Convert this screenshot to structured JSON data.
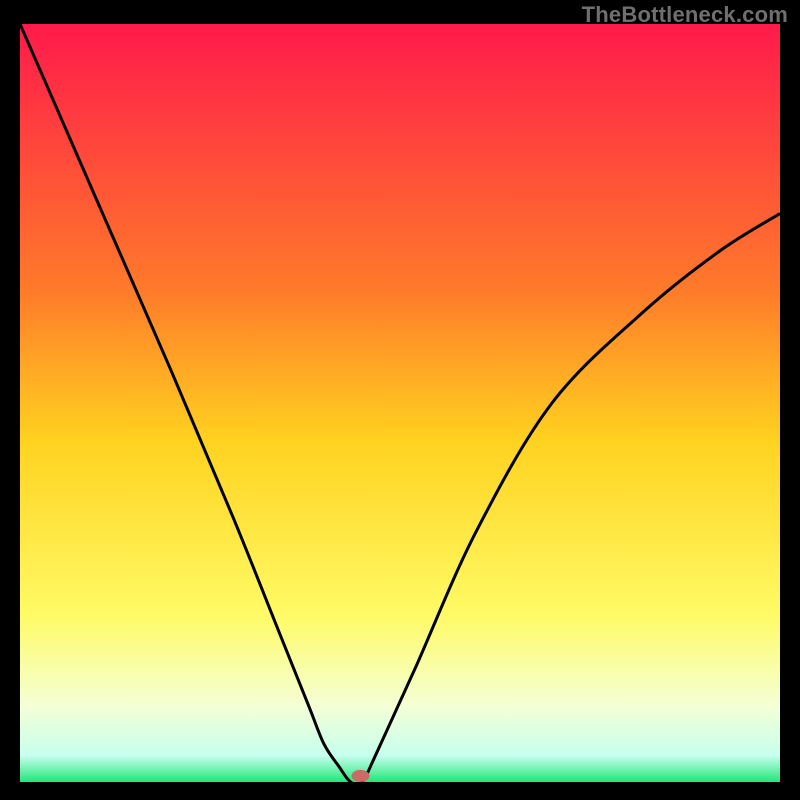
{
  "watermark": "TheBottleneck.com",
  "chart_data": {
    "type": "line",
    "title": "",
    "xlabel": "",
    "ylabel": "",
    "xlim": [
      0,
      100
    ],
    "ylim": [
      0,
      100
    ],
    "series": [
      {
        "name": "curve",
        "x": [
          0,
          10,
          20,
          28,
          34,
          38,
          40,
          42,
          43.5,
          45,
          47,
          52,
          60,
          70,
          82,
          92,
          100
        ],
        "y": [
          100,
          77,
          54,
          35,
          20,
          10,
          5,
          2,
          0,
          0,
          4,
          15,
          33,
          50,
          62,
          70,
          75
        ]
      }
    ],
    "marker": {
      "x": 44.8,
      "y": 0.8
    },
    "gradient_stops": [
      {
        "offset": 0.0,
        "color": "#ff1a4b"
      },
      {
        "offset": 0.35,
        "color": "#ff7a2a"
      },
      {
        "offset": 0.55,
        "color": "#ffd21f"
      },
      {
        "offset": 0.78,
        "color": "#fffb66"
      },
      {
        "offset": 0.9,
        "color": "#f4ffd6"
      },
      {
        "offset": 0.965,
        "color": "#c7ffee"
      },
      {
        "offset": 1.0,
        "color": "#23e67a"
      }
    ],
    "curve_color": "#000000",
    "marker_color": "#cc6a66"
  }
}
